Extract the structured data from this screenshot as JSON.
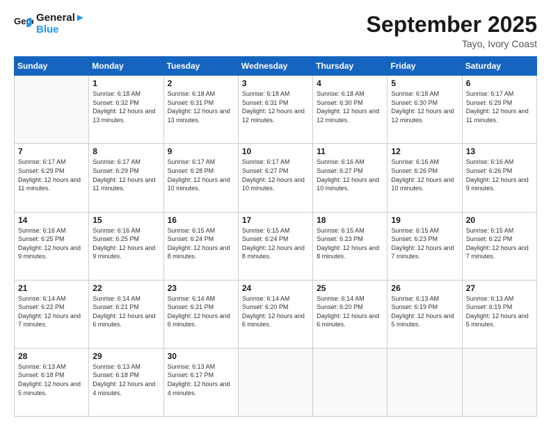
{
  "header": {
    "logo_line1": "General",
    "logo_line2": "Blue",
    "month": "September 2025",
    "location": "Tayo, Ivory Coast"
  },
  "weekdays": [
    "Sunday",
    "Monday",
    "Tuesday",
    "Wednesday",
    "Thursday",
    "Friday",
    "Saturday"
  ],
  "weeks": [
    [
      {
        "day": "",
        "sunrise": "",
        "sunset": "",
        "daylight": ""
      },
      {
        "day": "1",
        "sunrise": "Sunrise: 6:18 AM",
        "sunset": "Sunset: 6:32 PM",
        "daylight": "Daylight: 12 hours and 13 minutes."
      },
      {
        "day": "2",
        "sunrise": "Sunrise: 6:18 AM",
        "sunset": "Sunset: 6:31 PM",
        "daylight": "Daylight: 12 hours and 13 minutes."
      },
      {
        "day": "3",
        "sunrise": "Sunrise: 6:18 AM",
        "sunset": "Sunset: 6:31 PM",
        "daylight": "Daylight: 12 hours and 12 minutes."
      },
      {
        "day": "4",
        "sunrise": "Sunrise: 6:18 AM",
        "sunset": "Sunset: 6:30 PM",
        "daylight": "Daylight: 12 hours and 12 minutes."
      },
      {
        "day": "5",
        "sunrise": "Sunrise: 6:18 AM",
        "sunset": "Sunset: 6:30 PM",
        "daylight": "Daylight: 12 hours and 12 minutes."
      },
      {
        "day": "6",
        "sunrise": "Sunrise: 6:17 AM",
        "sunset": "Sunset: 6:29 PM",
        "daylight": "Daylight: 12 hours and 11 minutes."
      }
    ],
    [
      {
        "day": "7",
        "sunrise": "Sunrise: 6:17 AM",
        "sunset": "Sunset: 6:29 PM",
        "daylight": "Daylight: 12 hours and 11 minutes."
      },
      {
        "day": "8",
        "sunrise": "Sunrise: 6:17 AM",
        "sunset": "Sunset: 6:29 PM",
        "daylight": "Daylight: 12 hours and 11 minutes."
      },
      {
        "day": "9",
        "sunrise": "Sunrise: 6:17 AM",
        "sunset": "Sunset: 6:28 PM",
        "daylight": "Daylight: 12 hours and 10 minutes."
      },
      {
        "day": "10",
        "sunrise": "Sunrise: 6:17 AM",
        "sunset": "Sunset: 6:27 PM",
        "daylight": "Daylight: 12 hours and 10 minutes."
      },
      {
        "day": "11",
        "sunrise": "Sunrise: 6:16 AM",
        "sunset": "Sunset: 6:27 PM",
        "daylight": "Daylight: 12 hours and 10 minutes."
      },
      {
        "day": "12",
        "sunrise": "Sunrise: 6:16 AM",
        "sunset": "Sunset: 6:26 PM",
        "daylight": "Daylight: 12 hours and 10 minutes."
      },
      {
        "day": "13",
        "sunrise": "Sunrise: 6:16 AM",
        "sunset": "Sunset: 6:26 PM",
        "daylight": "Daylight: 12 hours and 9 minutes."
      }
    ],
    [
      {
        "day": "14",
        "sunrise": "Sunrise: 6:16 AM",
        "sunset": "Sunset: 6:25 PM",
        "daylight": "Daylight: 12 hours and 9 minutes."
      },
      {
        "day": "15",
        "sunrise": "Sunrise: 6:16 AM",
        "sunset": "Sunset: 6:25 PM",
        "daylight": "Daylight: 12 hours and 9 minutes."
      },
      {
        "day": "16",
        "sunrise": "Sunrise: 6:15 AM",
        "sunset": "Sunset: 6:24 PM",
        "daylight": "Daylight: 12 hours and 8 minutes."
      },
      {
        "day": "17",
        "sunrise": "Sunrise: 6:15 AM",
        "sunset": "Sunset: 6:24 PM",
        "daylight": "Daylight: 12 hours and 8 minutes."
      },
      {
        "day": "18",
        "sunrise": "Sunrise: 6:15 AM",
        "sunset": "Sunset: 6:23 PM",
        "daylight": "Daylight: 12 hours and 8 minutes."
      },
      {
        "day": "19",
        "sunrise": "Sunrise: 6:15 AM",
        "sunset": "Sunset: 6:23 PM",
        "daylight": "Daylight: 12 hours and 7 minutes."
      },
      {
        "day": "20",
        "sunrise": "Sunrise: 6:15 AM",
        "sunset": "Sunset: 6:22 PM",
        "daylight": "Daylight: 12 hours and 7 minutes."
      }
    ],
    [
      {
        "day": "21",
        "sunrise": "Sunrise: 6:14 AM",
        "sunset": "Sunset: 6:22 PM",
        "daylight": "Daylight: 12 hours and 7 minutes."
      },
      {
        "day": "22",
        "sunrise": "Sunrise: 6:14 AM",
        "sunset": "Sunset: 6:21 PM",
        "daylight": "Daylight: 12 hours and 6 minutes."
      },
      {
        "day": "23",
        "sunrise": "Sunrise: 6:14 AM",
        "sunset": "Sunset: 6:21 PM",
        "daylight": "Daylight: 12 hours and 6 minutes."
      },
      {
        "day": "24",
        "sunrise": "Sunrise: 6:14 AM",
        "sunset": "Sunset: 6:20 PM",
        "daylight": "Daylight: 12 hours and 6 minutes."
      },
      {
        "day": "25",
        "sunrise": "Sunrise: 6:14 AM",
        "sunset": "Sunset: 6:20 PM",
        "daylight": "Daylight: 12 hours and 6 minutes."
      },
      {
        "day": "26",
        "sunrise": "Sunrise: 6:13 AM",
        "sunset": "Sunset: 6:19 PM",
        "daylight": "Daylight: 12 hours and 5 minutes."
      },
      {
        "day": "27",
        "sunrise": "Sunrise: 6:13 AM",
        "sunset": "Sunset: 6:19 PM",
        "daylight": "Daylight: 12 hours and 5 minutes."
      }
    ],
    [
      {
        "day": "28",
        "sunrise": "Sunrise: 6:13 AM",
        "sunset": "Sunset: 6:18 PM",
        "daylight": "Daylight: 12 hours and 5 minutes."
      },
      {
        "day": "29",
        "sunrise": "Sunrise: 6:13 AM",
        "sunset": "Sunset: 6:18 PM",
        "daylight": "Daylight: 12 hours and 4 minutes."
      },
      {
        "day": "30",
        "sunrise": "Sunrise: 6:13 AM",
        "sunset": "Sunset: 6:17 PM",
        "daylight": "Daylight: 12 hours and 4 minutes."
      },
      {
        "day": "",
        "sunrise": "",
        "sunset": "",
        "daylight": ""
      },
      {
        "day": "",
        "sunrise": "",
        "sunset": "",
        "daylight": ""
      },
      {
        "day": "",
        "sunrise": "",
        "sunset": "",
        "daylight": ""
      },
      {
        "day": "",
        "sunrise": "",
        "sunset": "",
        "daylight": ""
      }
    ]
  ]
}
